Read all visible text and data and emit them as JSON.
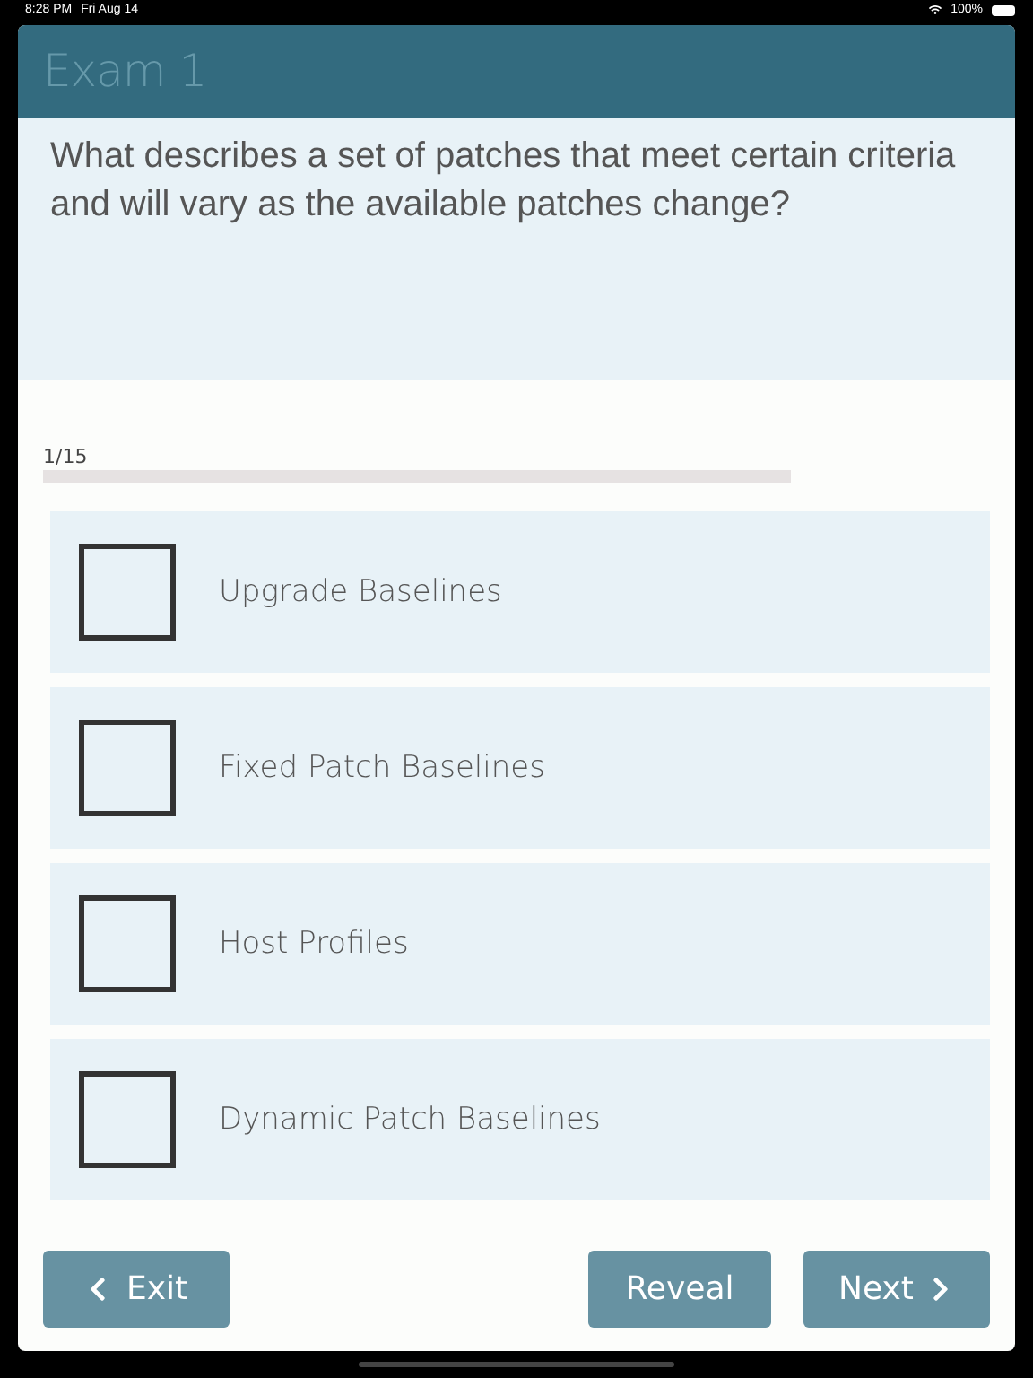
{
  "status_bar": {
    "time": "8:28 PM",
    "date": "Fri Aug 14",
    "battery": "100%"
  },
  "header": {
    "title": "Exam 1"
  },
  "question": {
    "text": "What describes a set of patches that meet certain criteria and will vary as the available patches change?"
  },
  "progress": {
    "label": "1/15",
    "level": 0
  },
  "options": [
    {
      "label": "Upgrade Baselines",
      "checked": false
    },
    {
      "label": "Fixed Patch Baselines",
      "checked": false
    },
    {
      "label": "Host Profiles",
      "checked": false
    },
    {
      "label": "Dynamic Patch Baselines",
      "checked": false
    }
  ],
  "buttons": {
    "exit": "Exit",
    "reveal": "Reveal",
    "next": "Next"
  }
}
